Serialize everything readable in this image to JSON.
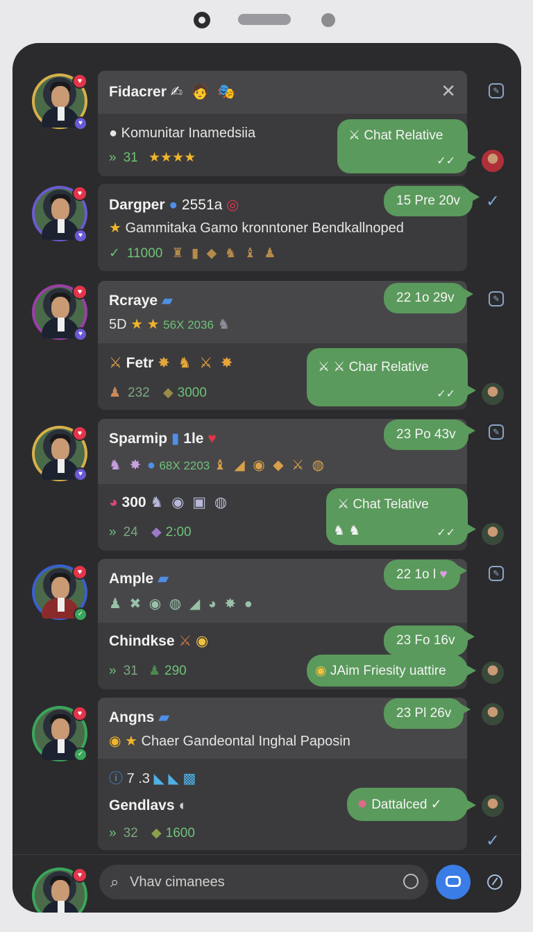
{
  "chats": [
    {
      "name": "Fidacrer",
      "name_icons": "✍ 🧑 🎭",
      "line": "Komunitar Inamedsiia",
      "meta_count": "31",
      "meta_stars": "★★★★",
      "bubble": "Chat Relative",
      "close_label": "✕"
    },
    {
      "name": "Dargper",
      "name_extra": "2551a",
      "line": "Gammitaka Gamo kronntoner Bendkallnoped",
      "meta_count": "11000",
      "time": "15 Pre 20v"
    },
    {
      "name": "Rcraye",
      "line_prefix": "5D",
      "line_suffix": "56X 2036",
      "time": "22 1o 29v",
      "sub_name": "Fetr",
      "sub_count_a": "232",
      "sub_count_b": "3000",
      "bubble": "Char Relative"
    },
    {
      "name": "Sparmip",
      "name_extra": "1le",
      "line_suffix": "68X 2203",
      "time": "23 Po 43v",
      "sub_name": "300",
      "sub_count_a": "24",
      "sub_count_b": "2:00",
      "bubble": "Chat Telative"
    },
    {
      "name": "Ample",
      "time": "22 1o l",
      "sub_name": "Chindkse",
      "sub_time": "23 Fo 16v",
      "sub_count_a": "31",
      "sub_count_b": "290",
      "bubble": "JAim Friesity uattire"
    },
    {
      "name": "Angns",
      "line": "Chaer Gandeontal Inghal Paposin",
      "time": "23 Pl 26v",
      "sub_line": "7 .3",
      "sub_name": "Gendlavs",
      "sub_count_a": "32",
      "sub_count_b": "1600",
      "bubble": "Dattalced"
    }
  ],
  "search": {
    "placeholder": "Vhav cimanees"
  },
  "colors": {
    "background": "#2b2b2d",
    "card": "#3b3b3d",
    "bubble": "#5a9a5c",
    "accent": "#3b7de6",
    "star": "#f0b52a"
  },
  "icons": {
    "close": "close-icon",
    "edit": "edit-icon",
    "check": "check-icon",
    "search": "search-icon",
    "send": "send-icon"
  }
}
